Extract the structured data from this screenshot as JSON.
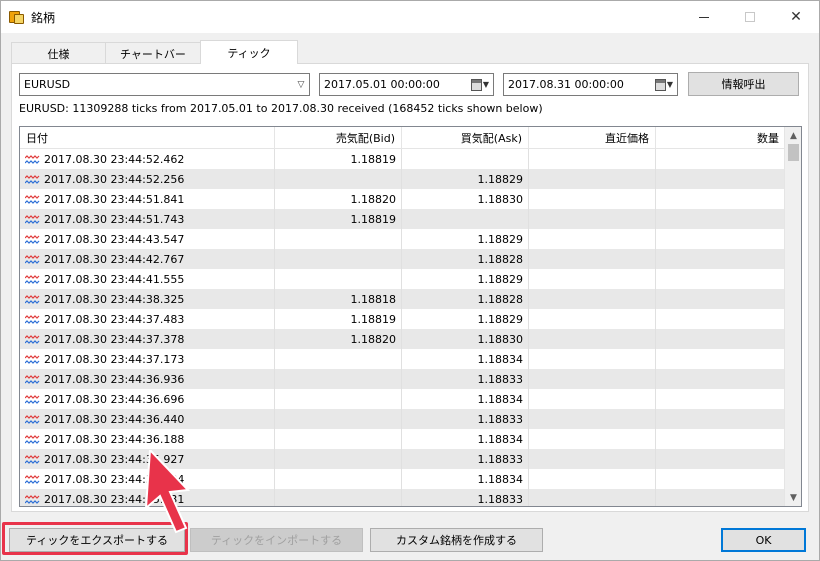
{
  "window": {
    "title": "銘柄"
  },
  "tabs": [
    {
      "label": "仕様",
      "active": false
    },
    {
      "label": "チャートバー",
      "active": false
    },
    {
      "label": "ティック",
      "active": true
    }
  ],
  "toolbar": {
    "symbol": "EURUSD",
    "date_from": "2017.05.01 00:00:00",
    "date_to": "2017.08.31 00:00:00",
    "request_label": "情報呼出"
  },
  "status_text": "EURUSD: 11309288 ticks from 2017.05.01 to 2017.08.30 received (168452 ticks shown below)",
  "table": {
    "headers": [
      "日付",
      "売気配(Bid)",
      "買気配(Ask)",
      "直近価格",
      "数量"
    ],
    "rows": [
      [
        "2017.08.30 23:44:52.462",
        "1.18819",
        "",
        "",
        ""
      ],
      [
        "2017.08.30 23:44:52.256",
        "",
        "1.18829",
        "",
        ""
      ],
      [
        "2017.08.30 23:44:51.841",
        "1.18820",
        "1.18830",
        "",
        ""
      ],
      [
        "2017.08.30 23:44:51.743",
        "1.18819",
        "",
        "",
        ""
      ],
      [
        "2017.08.30 23:44:43.547",
        "",
        "1.18829",
        "",
        ""
      ],
      [
        "2017.08.30 23:44:42.767",
        "",
        "1.18828",
        "",
        ""
      ],
      [
        "2017.08.30 23:44:41.555",
        "",
        "1.18829",
        "",
        ""
      ],
      [
        "2017.08.30 23:44:38.325",
        "1.18818",
        "1.18828",
        "",
        ""
      ],
      [
        "2017.08.30 23:44:37.483",
        "1.18819",
        "1.18829",
        "",
        ""
      ],
      [
        "2017.08.30 23:44:37.378",
        "1.18820",
        "1.18830",
        "",
        ""
      ],
      [
        "2017.08.30 23:44:37.173",
        "",
        "1.18834",
        "",
        ""
      ],
      [
        "2017.08.30 23:44:36.936",
        "",
        "1.18833",
        "",
        ""
      ],
      [
        "2017.08.30 23:44:36.696",
        "",
        "1.18834",
        "",
        ""
      ],
      [
        "2017.08.30 23:44:36.440",
        "",
        "1.18833",
        "",
        ""
      ],
      [
        "2017.08.30 23:44:36.188",
        "",
        "1.18834",
        "",
        ""
      ],
      [
        "2017.08.30 23:44:35.927",
        "",
        "1.18833",
        "",
        ""
      ],
      [
        "2017.08.30 23:44:35.684",
        "",
        "1.18834",
        "",
        ""
      ],
      [
        "2017.08.30 23:44:35.431",
        "",
        "1.18833",
        "",
        ""
      ]
    ]
  },
  "buttons": {
    "export": "ティックをエクスポートする",
    "import": "ティックをインポートする",
    "custom": "カスタム銘柄を作成する",
    "ok": "OK"
  },
  "colors": {
    "highlight": "#e8334a",
    "tick_icon_red": "#e03c3c",
    "tick_icon_blue": "#2d6fd6"
  }
}
